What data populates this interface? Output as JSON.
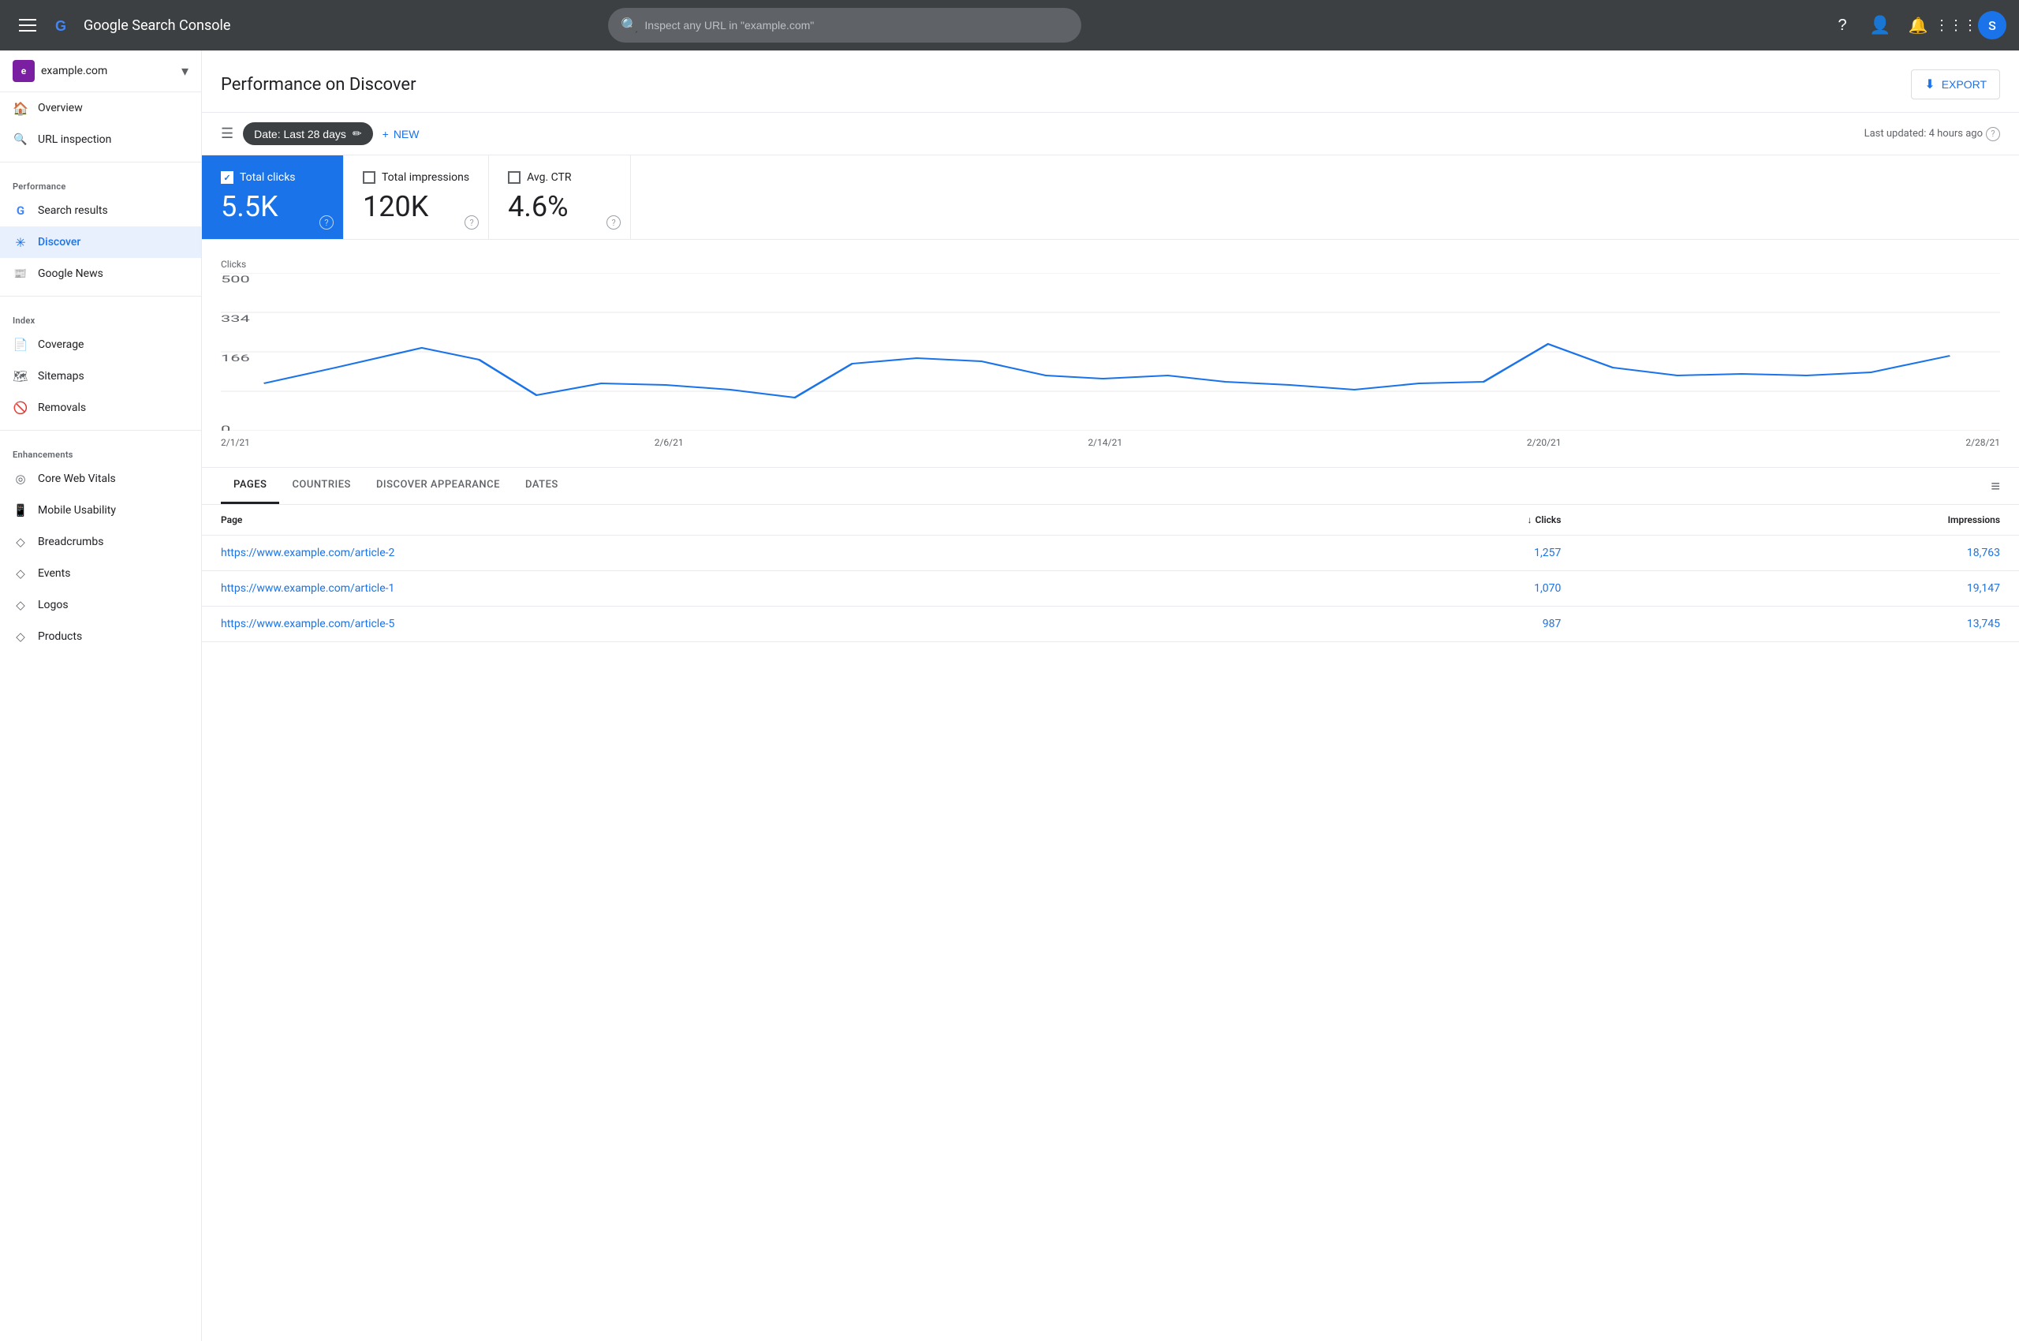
{
  "topNav": {
    "hamburger_label": "Menu",
    "brand": "Google Search Console",
    "search_placeholder": "Inspect any URL in \"example.com\"",
    "user_initial": "S",
    "user_avatar_bg": "#4285f4"
  },
  "sidebar": {
    "property": {
      "name": "example.com",
      "icon_letter": "e",
      "icon_bg": "#7b1fa2"
    },
    "nav_items": [
      {
        "id": "overview",
        "label": "Overview",
        "icon": "home",
        "active": false,
        "section": null
      },
      {
        "id": "url-inspection",
        "label": "URL inspection",
        "icon": "search",
        "active": false,
        "section": null
      },
      {
        "id": "performance-header",
        "label": "Performance",
        "icon": null,
        "active": false,
        "section": "PERFORMANCE",
        "is_section": true
      },
      {
        "id": "search-results",
        "label": "Search results",
        "icon": "g",
        "active": false,
        "section": "PERFORMANCE"
      },
      {
        "id": "discover",
        "label": "Discover",
        "icon": "asterisk",
        "active": true,
        "section": "PERFORMANCE"
      },
      {
        "id": "google-news",
        "label": "Google News",
        "icon": "news",
        "active": false,
        "section": "PERFORMANCE"
      },
      {
        "id": "index-header",
        "label": "Index",
        "icon": null,
        "active": false,
        "section": "INDEX",
        "is_section": true
      },
      {
        "id": "coverage",
        "label": "Coverage",
        "icon": "file",
        "active": false,
        "section": "INDEX"
      },
      {
        "id": "sitemaps",
        "label": "Sitemaps",
        "icon": "sitemaps",
        "active": false,
        "section": "INDEX"
      },
      {
        "id": "removals",
        "label": "Removals",
        "icon": "removals",
        "active": false,
        "section": "INDEX"
      },
      {
        "id": "enhancements-header",
        "label": "Enhancements",
        "icon": null,
        "active": false,
        "section": "ENHANCEMENTS",
        "is_section": true
      },
      {
        "id": "core-web-vitals",
        "label": "Core Web Vitals",
        "icon": "cwv",
        "active": false,
        "section": "ENHANCEMENTS"
      },
      {
        "id": "mobile-usability",
        "label": "Mobile Usability",
        "icon": "mobile",
        "active": false,
        "section": "ENHANCEMENTS"
      },
      {
        "id": "breadcrumbs",
        "label": "Breadcrumbs",
        "icon": "breadcrumbs",
        "active": false,
        "section": "ENHANCEMENTS"
      },
      {
        "id": "events",
        "label": "Events",
        "icon": "events",
        "active": false,
        "section": "ENHANCEMENTS"
      },
      {
        "id": "logos",
        "label": "Logos",
        "icon": "logos",
        "active": false,
        "section": "ENHANCEMENTS"
      },
      {
        "id": "products",
        "label": "Products",
        "icon": "products",
        "active": false,
        "section": "ENHANCEMENTS"
      }
    ]
  },
  "pageHeader": {
    "title": "Performance on Discover",
    "export_label": "EXPORT"
  },
  "filterBar": {
    "date_filter_label": "Date: Last 28 days",
    "new_label": "+ NEW",
    "last_updated": "Last updated: 4 hours ago"
  },
  "metrics": [
    {
      "id": "total-clicks",
      "label": "Total clicks",
      "value": "5.5K",
      "active": true,
      "checked": true
    },
    {
      "id": "total-impressions",
      "label": "Total impressions",
      "value": "120K",
      "active": false,
      "checked": false
    },
    {
      "id": "avg-ctr",
      "label": "Avg. CTR",
      "value": "4.6%",
      "active": false,
      "checked": false
    }
  ],
  "chart": {
    "y_label": "Clicks",
    "y_ticks": [
      "500",
      "334",
      "166",
      "0"
    ],
    "x_labels": [
      "2/1/21",
      "2/6/21",
      "2/14/21",
      "2/20/21",
      "2/28/21"
    ],
    "data_points": [
      {
        "x": 0,
        "y": 180
      },
      {
        "x": 50,
        "y": 220
      },
      {
        "x": 100,
        "y": 260
      },
      {
        "x": 130,
        "y": 230
      },
      {
        "x": 170,
        "y": 160
      },
      {
        "x": 210,
        "y": 185
      },
      {
        "x": 260,
        "y": 180
      },
      {
        "x": 300,
        "y": 175
      },
      {
        "x": 340,
        "y": 155
      },
      {
        "x": 390,
        "y": 210
      },
      {
        "x": 430,
        "y": 225
      },
      {
        "x": 480,
        "y": 220
      },
      {
        "x": 530,
        "y": 190
      },
      {
        "x": 570,
        "y": 185
      },
      {
        "x": 620,
        "y": 190
      },
      {
        "x": 660,
        "y": 180
      },
      {
        "x": 710,
        "y": 175
      },
      {
        "x": 760,
        "y": 165
      },
      {
        "x": 810,
        "y": 175
      },
      {
        "x": 860,
        "y": 175
      },
      {
        "x": 910,
        "y": 260
      },
      {
        "x": 960,
        "y": 200
      },
      {
        "x": 1010,
        "y": 185
      },
      {
        "x": 1060,
        "y": 190
      },
      {
        "x": 1110,
        "y": 185
      },
      {
        "x": 1160,
        "y": 190
      },
      {
        "x": 1210,
        "y": 220
      }
    ]
  },
  "tabs": {
    "items": [
      {
        "id": "pages",
        "label": "PAGES",
        "active": true
      },
      {
        "id": "countries",
        "label": "COUNTRIES",
        "active": false
      },
      {
        "id": "discover-appearance",
        "label": "DISCOVER APPEARANCE",
        "active": false
      },
      {
        "id": "dates",
        "label": "DATES",
        "active": false
      }
    ]
  },
  "table": {
    "columns": [
      {
        "id": "page",
        "label": "Page",
        "numeric": false,
        "sortable": false
      },
      {
        "id": "clicks",
        "label": "Clicks",
        "numeric": true,
        "sortable": true,
        "sort_dir": "desc"
      },
      {
        "id": "impressions",
        "label": "Impressions",
        "numeric": true,
        "sortable": false
      }
    ],
    "rows": [
      {
        "page": "https://www.example.com/article-2",
        "clicks": "1,257",
        "impressions": "18,763"
      },
      {
        "page": "https://www.example.com/article-1",
        "clicks": "1,070",
        "impressions": "19,147"
      },
      {
        "page": "https://www.example.com/article-5",
        "clicks": "987",
        "impressions": "13,745"
      }
    ]
  }
}
